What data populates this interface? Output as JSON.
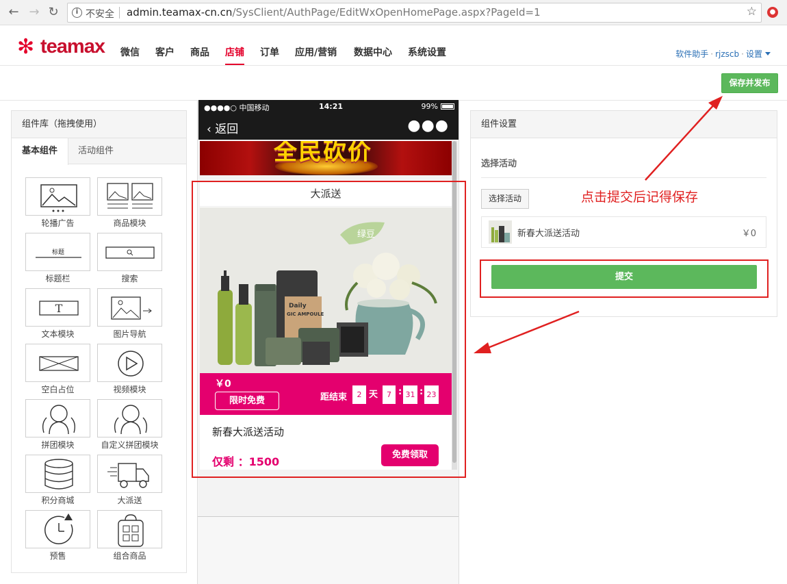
{
  "browser": {
    "insecure_label": "不安全",
    "url_domain": "admin.teamax-cn.cn",
    "url_path": "/SysClient/AuthPage/EditWxOpenHomePage.aspx?PageId=1"
  },
  "header": {
    "logo_text": "teamax",
    "nav": [
      "微信",
      "客户",
      "商品",
      "店铺",
      "订单",
      "应用/营销",
      "数据中心",
      "系统设置"
    ],
    "active_nav": "店铺",
    "user": {
      "helper": "软件助手",
      "username": "rjzscb",
      "settings": "设置"
    }
  },
  "toolbar": {
    "publish_label": "保存并发布"
  },
  "left_panel": {
    "title": "组件库（拖拽使用）",
    "tabs": [
      "基本组件",
      "活动组件"
    ],
    "components": [
      "轮播广告",
      "商品模块",
      "标题栏",
      "搜索",
      "文本模块",
      "图片导航",
      "空白占位",
      "视频模块",
      "拼团模块",
      "自定义拼团模块",
      "积分商城",
      "大派送",
      "预售",
      "组合商品"
    ],
    "title_bar_thumb_text": "标题",
    "text_module_thumb_text": "T"
  },
  "phone": {
    "carrier": "●●●●○ 中国移动",
    "time": "14:21",
    "battery": "99%",
    "back_label": "返回",
    "banner_text": "全民砍价",
    "card_title": "大派送",
    "brand_tag": "绿豆",
    "product_label_1": "Daily",
    "product_label_2": "GIC AMPOULE",
    "price": "￥0",
    "limited_tag": "限时免费",
    "countdown_label": "距结束",
    "countdown": {
      "days": "2",
      "day_unit": "天",
      "hours": "7",
      "minutes": "31",
      "seconds": "23"
    },
    "activity_name": "新春大派送活动",
    "remaining": "仅剩 ：1500",
    "claim_button": "免费领取"
  },
  "right_panel": {
    "title": "组件设置",
    "select_label": "选择活动",
    "select_button": "选择活动",
    "activity": {
      "name": "新春大派送活动",
      "price": "￥0"
    },
    "submit_label": "提交"
  },
  "annotation": "点击提交后记得保存",
  "colors": {
    "accent_red": "#e4002b",
    "promo_pink": "#e4006e",
    "green": "#5cb85c",
    "annotation_red": "#e02020"
  }
}
